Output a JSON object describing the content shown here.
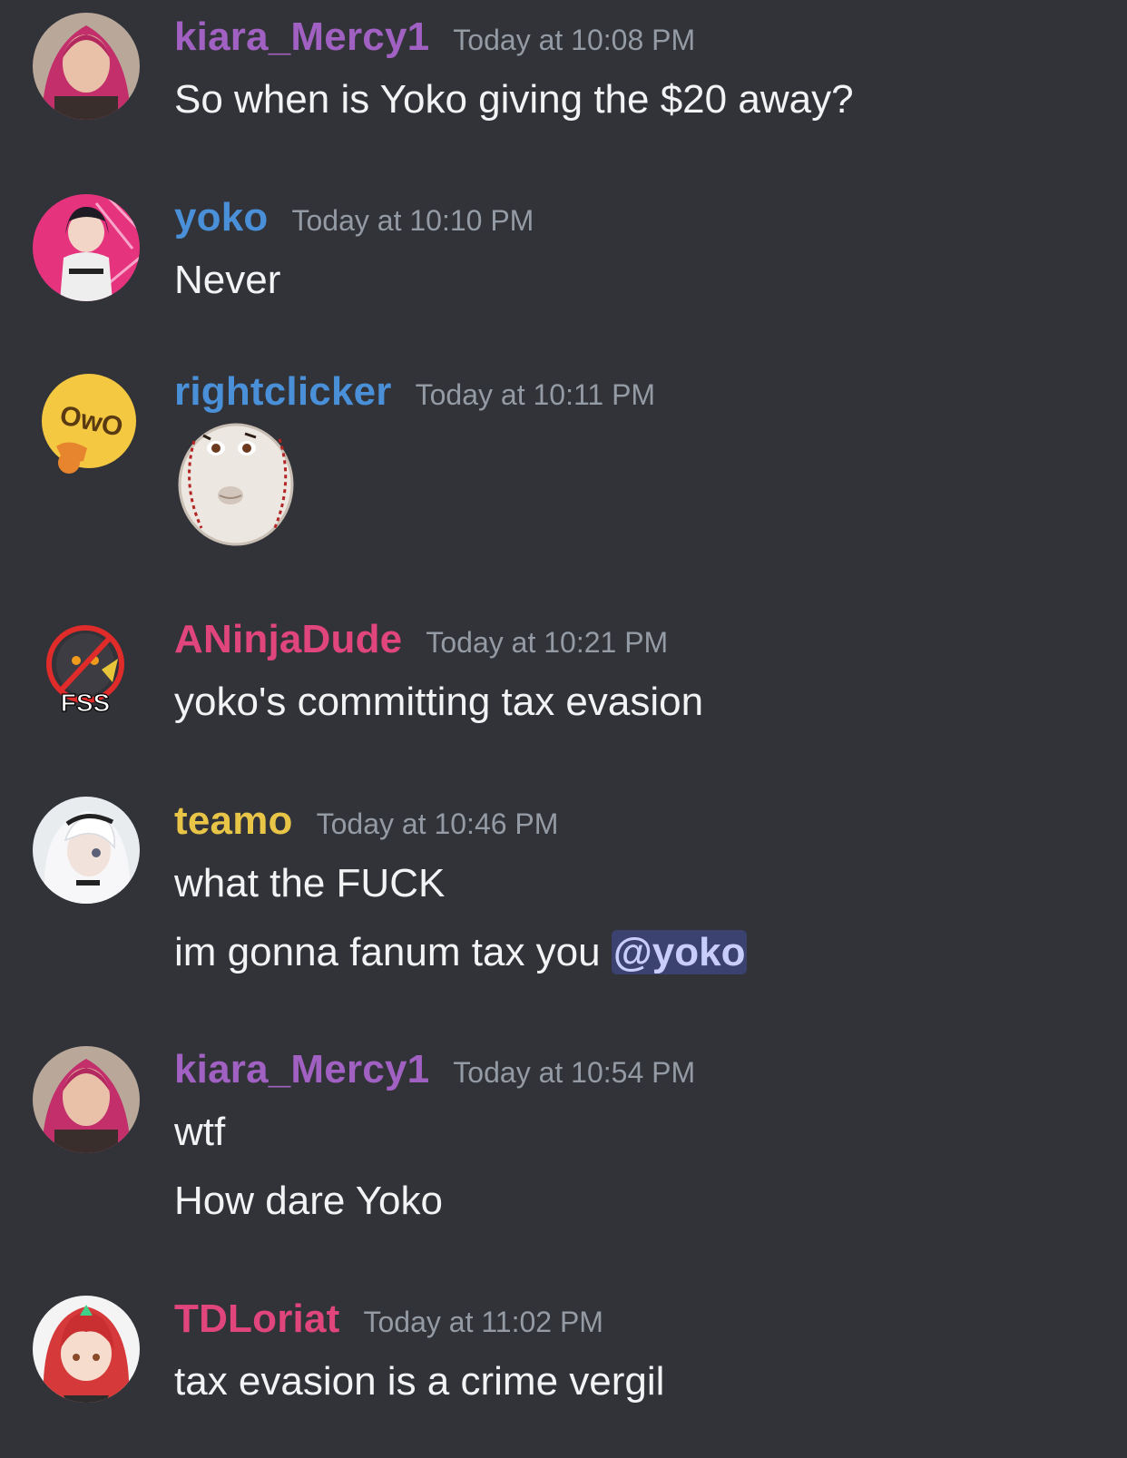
{
  "colors": {
    "background": "#313338",
    "timestamp": "#949ba4",
    "message_text": "#f2f3f5",
    "mention_bg": "#3c4270",
    "mention_text": "#c9cdfb"
  },
  "messages": [
    {
      "username": "kiara_Mercy1",
      "username_color": "#a161c2",
      "timestamp": "Today at 10:08 PM",
      "avatar_icon": "user-avatar-kiara",
      "lines": [
        "So when is Yoko giving the $20 away?"
      ]
    },
    {
      "username": "yoko",
      "username_color": "#4a90d9",
      "timestamp": "Today at 10:10 PM",
      "avatar_icon": "user-avatar-yoko",
      "lines": [
        "Never"
      ]
    },
    {
      "username": "rightclicker",
      "username_color": "#4a90d9",
      "timestamp": "Today at 10:11 PM",
      "avatar_icon": "owo-emoji-avatar",
      "sticker": "baseball-face-sticker"
    },
    {
      "username": "ANinjaDude",
      "username_color": "#e0457b",
      "timestamp": "Today at 10:21 PM",
      "avatar_icon": "fss-avatar",
      "avatar_label": "FSS",
      "lines": [
        "yoko's committing tax evasion"
      ]
    },
    {
      "username": "teamo",
      "username_color": "#e8c547",
      "timestamp": "Today at 10:46 PM",
      "avatar_icon": "user-avatar-teamo",
      "lines": [
        "what the FUCK",
        "im gonna fanum tax you"
      ],
      "mention": "@yoko"
    },
    {
      "username": "kiara_Mercy1",
      "username_color": "#a161c2",
      "timestamp": "Today at 10:54 PM",
      "avatar_icon": "user-avatar-kiara",
      "lines": [
        "wtf",
        "How dare Yoko"
      ]
    },
    {
      "username": "TDLoriat",
      "username_color": "#e0457b",
      "timestamp": "Today at 11:02 PM",
      "avatar_icon": "user-avatar-tdloriat",
      "lines": [
        "tax evasion is a crime vergil"
      ]
    }
  ]
}
